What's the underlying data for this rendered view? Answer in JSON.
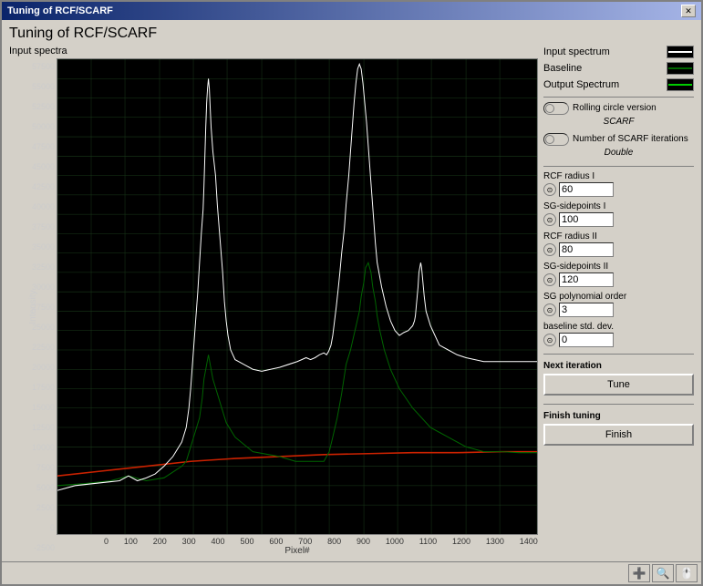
{
  "window": {
    "title": "Tuning of RCF/SCARF",
    "close_btn": "✕"
  },
  "page": {
    "title": "Tuning of RCF/SCARF",
    "chart_label": "Input spectra"
  },
  "legend": {
    "items": [
      {
        "label": "Input spectrum",
        "color": "white"
      },
      {
        "label": "Baseline",
        "color": "darkgreen"
      },
      {
        "label": "Output Spectrum",
        "color": "green"
      }
    ]
  },
  "options": {
    "rolling_circle": {
      "label": "Rolling circle version",
      "value": "SCARF"
    },
    "scarf_iterations": {
      "label": "Number of SCARF iterations",
      "value": "Double"
    }
  },
  "fields": [
    {
      "label": "RCF radius I",
      "value": "60",
      "id": "rcf-radius-1"
    },
    {
      "label": "SG-sidepoints I",
      "value": "100",
      "id": "sg-sidepoints-1"
    },
    {
      "label": "RCF radius II",
      "value": "80",
      "id": "rcf-radius-2"
    },
    {
      "label": "SG-sidepoints II",
      "value": "120",
      "id": "sg-sidepoints-2"
    },
    {
      "label": "SG polynomial order",
      "value": "3",
      "id": "sg-poly-order"
    },
    {
      "label": "baseline std. dev.",
      "value": "0",
      "id": "baseline-std-dev"
    }
  ],
  "next_iteration": {
    "label": "Next iteration",
    "btn_label": "Tune"
  },
  "finish": {
    "label": "Finish tuning",
    "btn_label": "Finish"
  },
  "y_axis": {
    "labels": [
      "57500",
      "55000",
      "52500",
      "50000",
      "47500",
      "45000",
      "42500",
      "40000",
      "37500",
      "35000",
      "32500",
      "30000",
      "27500",
      "25000",
      "22500",
      "20000",
      "17500",
      "15000",
      "12500",
      "10000",
      "7500",
      "5000",
      "2500",
      "0",
      "-2500"
    ]
  },
  "x_axis": {
    "labels": [
      "0",
      "100",
      "200",
      "300",
      "400",
      "500",
      "600",
      "700",
      "800",
      "900",
      "1000",
      "1100",
      "1200",
      "1300",
      "1400"
    ]
  },
  "x_axis_title": "Pixel#",
  "y_axis_title": "Intensity",
  "bottom_tools": [
    "➕",
    "🔍",
    "🖱️"
  ]
}
